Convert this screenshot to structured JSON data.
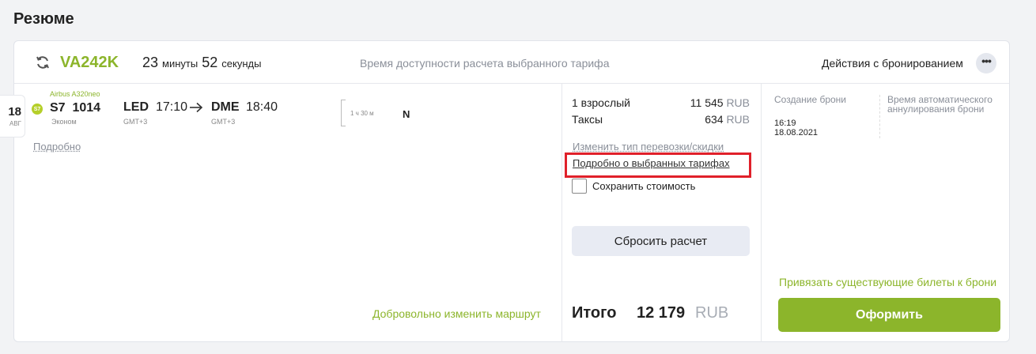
{
  "page": {
    "title": "Резюме"
  },
  "header": {
    "pnr": "VA242K",
    "timer": {
      "minutes": "23",
      "minutes_unit": "минуты",
      "seconds": "52",
      "seconds_unit": "секунды"
    },
    "availability_text": "Время доступности расчета выбранного тарифа",
    "actions_label": "Действия с бронированием",
    "more_label": "•••"
  },
  "segment": {
    "date_day": "18",
    "date_month": "АВГ",
    "airline_logo": "S7",
    "aircraft": "Airbus A320neo",
    "flight_number": "S7  1014",
    "cabin": "Эконом",
    "departure": {
      "code": "LED",
      "time": "17:10",
      "tz": "GMT+3"
    },
    "arrival": {
      "code": "DME",
      "time": "18:40",
      "tz": "GMT+3"
    },
    "duration": "1 ч 30 м",
    "booking_class": "N",
    "details_link": "Подробно",
    "change_route_link": "Добровольно изменить маршрут"
  },
  "pricing": {
    "rows": [
      {
        "label": "1 взрослый",
        "amount": "11 545",
        "currency": "RUB"
      },
      {
        "label": "Таксы",
        "amount": "634",
        "currency": "RUB"
      }
    ],
    "change_type_link": "Изменить тип перевозки/скидки",
    "fares_details_link": "Подробно о выбранных тарифах",
    "save_price_label": "Сохранить стоимость",
    "reset_button": "Сбросить расчет",
    "total_label": "Итого",
    "total_amount": "12 179",
    "total_currency": "RUB"
  },
  "booking_meta": {
    "created_label": "Создание брони",
    "auto_cancel_label": "Время автоматического аннулирования брони",
    "created_time": "16:19",
    "created_date": "18.08.2021",
    "attach_tickets_link": "Привязать существующие билеты к брони",
    "submit_button": "Оформить"
  },
  "colors": {
    "accent": "#8cb52b",
    "highlight": "#e0202a",
    "muted": "#8a8f99"
  }
}
